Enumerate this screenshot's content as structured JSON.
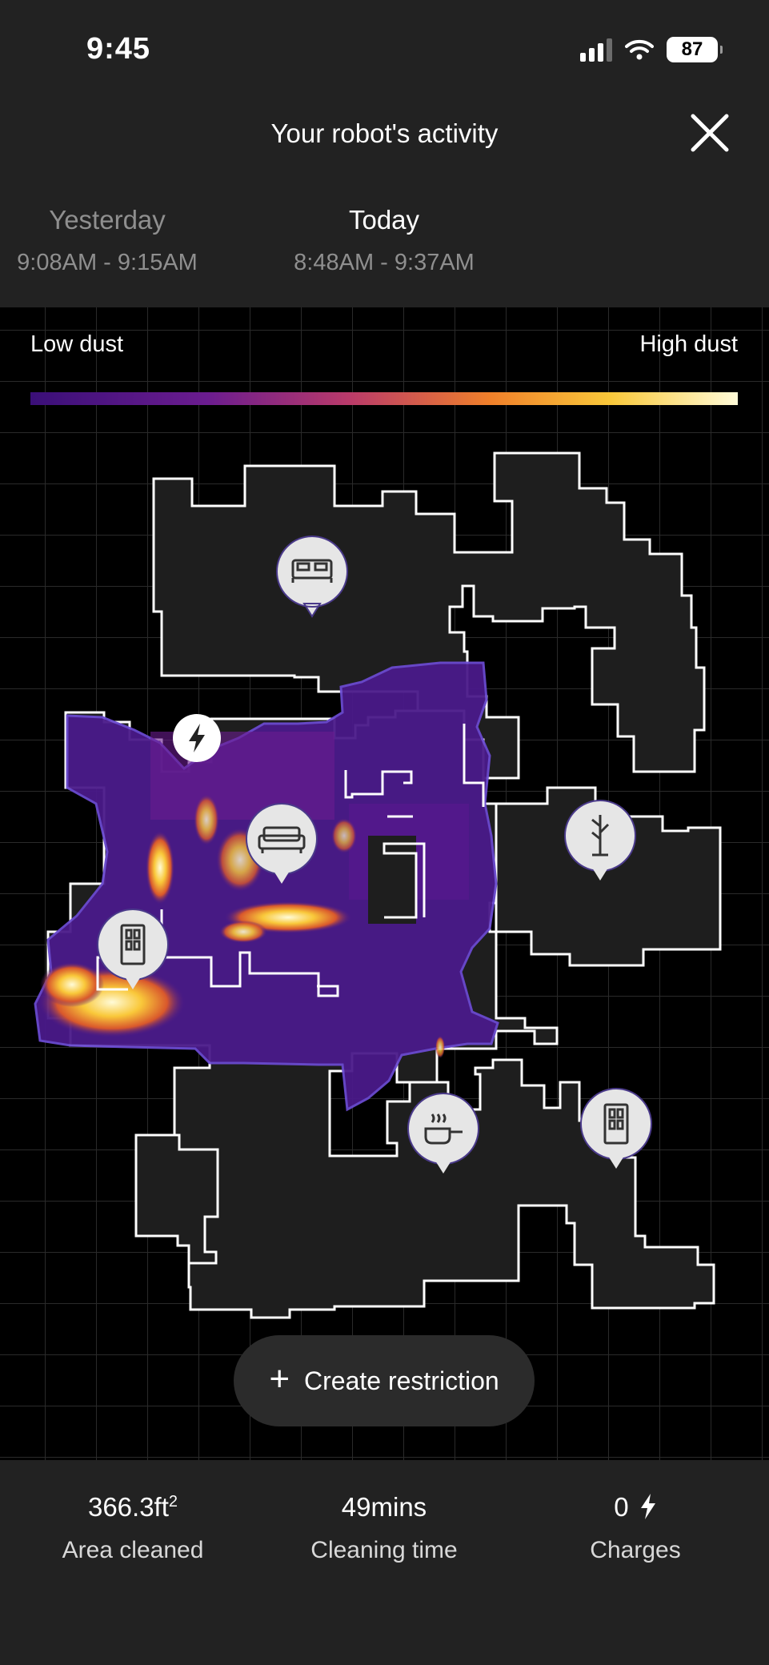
{
  "status_bar": {
    "time": "9:45",
    "battery_percent": "87",
    "icons": [
      "signal-icon",
      "wifi-icon",
      "battery-icon"
    ]
  },
  "header": {
    "title": "Your robot's activity",
    "close_icon": "close-icon",
    "tabs": [
      {
        "label": "Yesterday",
        "range": "9:08AM - 9:15AM",
        "active": false
      },
      {
        "label": "Today",
        "range": "8:48AM - 9:37AM",
        "active": true
      }
    ]
  },
  "legend": {
    "low_label": "Low dust",
    "high_label": "High dust",
    "gradient": [
      "#3a0f78",
      "#6b1c8f",
      "#b93a6a",
      "#f0802a",
      "#f9c83a",
      "#fffbd8"
    ]
  },
  "map": {
    "room_icons": [
      "bed-icon",
      "sofa-icon",
      "door-icon",
      "coat-rack-icon",
      "cooking-pot-icon",
      "door-icon",
      "charging-dock-icon"
    ],
    "colors": {
      "room_fill": "#1e1e1e",
      "wall": "#ffffff",
      "cleaned": "#4a1a8a",
      "grid": "#2a2a2a"
    }
  },
  "actions": {
    "create_restriction": "Create restriction"
  },
  "stats": {
    "area_value": "366.3ft",
    "area_unit_sup": "2",
    "area_caption": "Area cleaned",
    "time_value": "49mins",
    "time_caption": "Cleaning time",
    "charges_value": "0",
    "charges_caption": "Charges"
  }
}
